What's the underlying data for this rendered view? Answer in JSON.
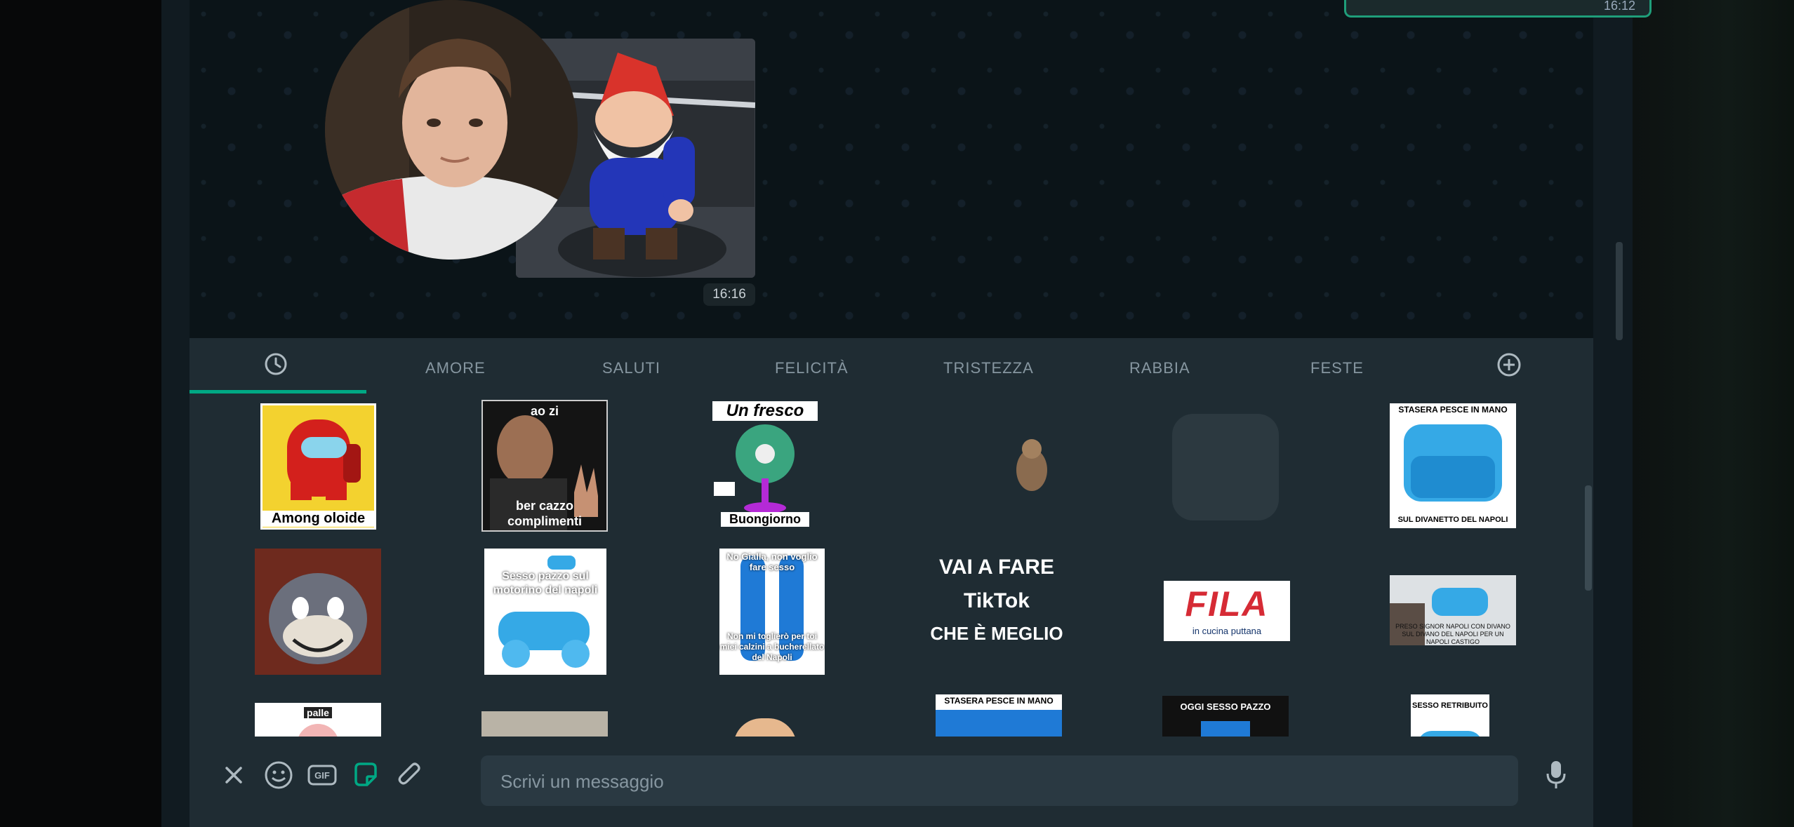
{
  "chat": {
    "top_media_time": "16:12",
    "sticker_time": "16:16"
  },
  "tabs": [
    "AMORE",
    "SALUTI",
    "FELICITÀ",
    "TRISTEZZA",
    "RABBIA",
    "FESTE"
  ],
  "stickers": {
    "among_caption": "Among oloide",
    "vin_top": "ao zi",
    "vin_bottom": "ber cazzo complimenti",
    "fan_top": "Un fresco",
    "fan_bottom": "Buongiorno",
    "chair_caption_top": "STASERA PESCE IN MANO",
    "chair_caption_bottom": "SUL DIVANETTO DEL NAPOLI",
    "moto_caption": "Sesso pazzo sul motorino del napoli",
    "socks_top": "No Gialla, non voglio fare sesso",
    "socks_bottom": "Non mi toglierò per toi miei calzini a bucherellato del Napoli",
    "tiktok_line1": "VAI A FARE",
    "tiktok_line2": "TikTok",
    "tiktok_line3": "CHE È MEGLIO",
    "fila_logo": "FILA",
    "fila_sub": "in cucina puttana",
    "wide_caption": "PRESO SIGNOR NAPOLI CON DIVANO SUL DIVANO DEL NAPOLI PER UN NAPOLI CASTIGO",
    "r3_1": "palle",
    "r3_4": "STASERA PESCE IN MANO",
    "r3_5": "OGGI SESSO PAZZO",
    "r3_6": "SESSO RETRIBUITO"
  },
  "composer": {
    "placeholder": "Scrivi un messaggio"
  },
  "icons": [
    "close-icon",
    "emoji-icon",
    "gif-icon",
    "sticker-icon",
    "attach-icon",
    "mic-icon",
    "clock-icon",
    "plus-circle-icon"
  ],
  "colors": {
    "accent": "#00a884",
    "panel": "#1f2c33",
    "input": "#2a3942"
  }
}
